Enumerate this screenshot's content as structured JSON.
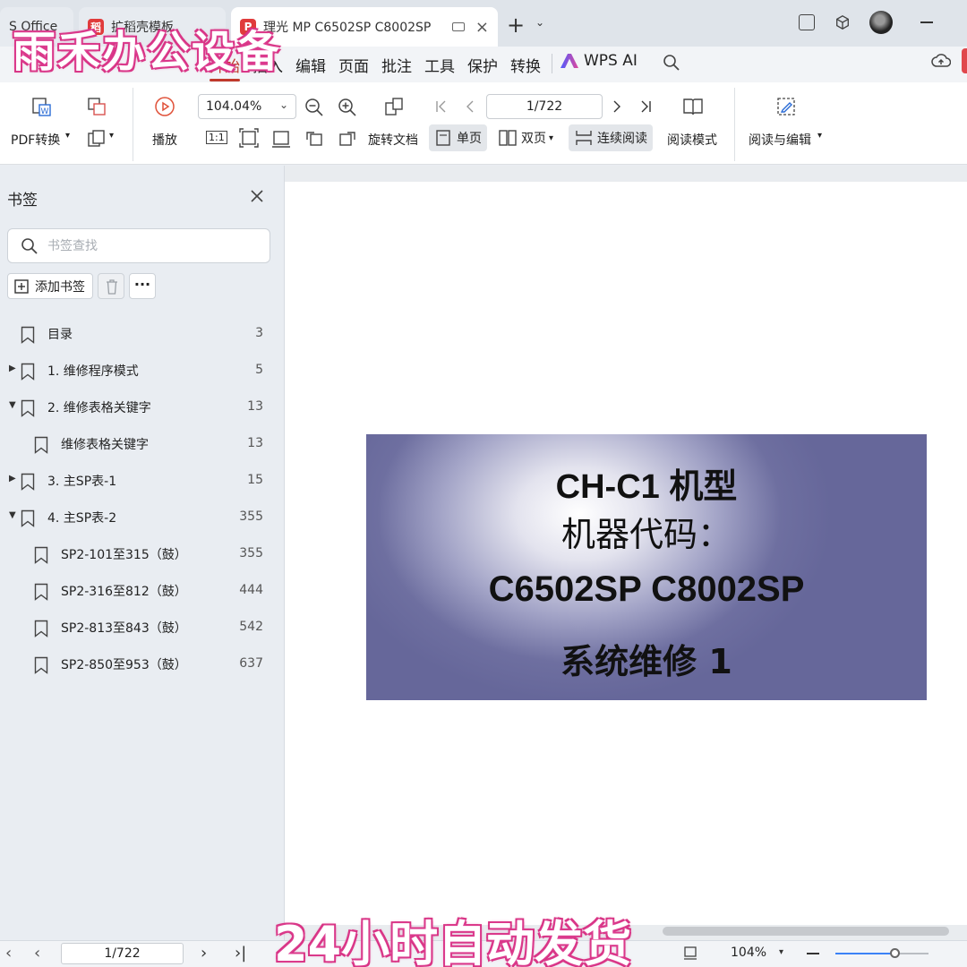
{
  "tabs": [
    {
      "label": "S Office"
    },
    {
      "label": "扩稻壳模板"
    },
    {
      "label": "理光 MP C6502SP C8002SP",
      "icon": "pdf-icon",
      "close": "×"
    }
  ],
  "titlebar": {
    "new_tab": "+",
    "new_tab_dropdown": "⌄"
  },
  "menu": {
    "items": [
      "开始",
      "插入",
      "编辑",
      "页面",
      "批注",
      "工具",
      "保护",
      "转换"
    ],
    "active": "开始",
    "wps_ai": "WPS AI"
  },
  "toolbar": {
    "pdf_convert": "PDF转换",
    "play": "播放",
    "zoom_value": "104.04%",
    "page_value": "1/722",
    "rotate_doc": "旋转文档",
    "single_page": "单页",
    "double_page": "双页",
    "continuous_read": "连续阅读",
    "read_mode": "阅读模式",
    "read_and_edit": "阅读与编辑",
    "actual_size": "1:1"
  },
  "sidebar": {
    "title": "书签",
    "search_placeholder": "书签查找",
    "add_bookmark": "添加书签",
    "more": "···",
    "items": [
      {
        "label": "目录",
        "page": "3",
        "level": 0,
        "arrow": ""
      },
      {
        "label": "1. 维修程序模式",
        "page": "5",
        "level": 0,
        "arrow": "▶"
      },
      {
        "label": "2. 维修表格关键字",
        "page": "13",
        "level": 0,
        "arrow": "▼"
      },
      {
        "label": "维修表格关键字",
        "page": "13",
        "level": 1,
        "arrow": ""
      },
      {
        "label": "3. 主SP表-1",
        "page": "15",
        "level": 0,
        "arrow": "▶"
      },
      {
        "label": "4. 主SP表-2",
        "page": "355",
        "level": 0,
        "arrow": "▼"
      },
      {
        "label": "SP2-101至315（鼓）",
        "page": "355",
        "level": 1,
        "arrow": ""
      },
      {
        "label": "SP2-316至812（鼓）",
        "page": "444",
        "level": 1,
        "arrow": ""
      },
      {
        "label": "SP2-813至843（鼓）",
        "page": "542",
        "level": 1,
        "arrow": ""
      },
      {
        "label": "SP2-850至953（鼓）",
        "page": "637",
        "level": 1,
        "arrow": ""
      }
    ]
  },
  "document": {
    "line1": "CH-C1 机型",
    "line2": "机器代码：",
    "line3": "C6502SP C8002SP",
    "line4": "系统维修 1"
  },
  "statusbar": {
    "page_value": "1/722",
    "zoom": "104%",
    "prev": "‹",
    "next": "›",
    "last": "›|",
    "first": "|‹"
  },
  "watermarks": {
    "top": "雨禾办公设备",
    "bottom": "24小时自动发货"
  },
  "colors": {
    "accent": "#c0392b",
    "watermark_outline": "#d6307f",
    "cover_base": "#66679a"
  }
}
